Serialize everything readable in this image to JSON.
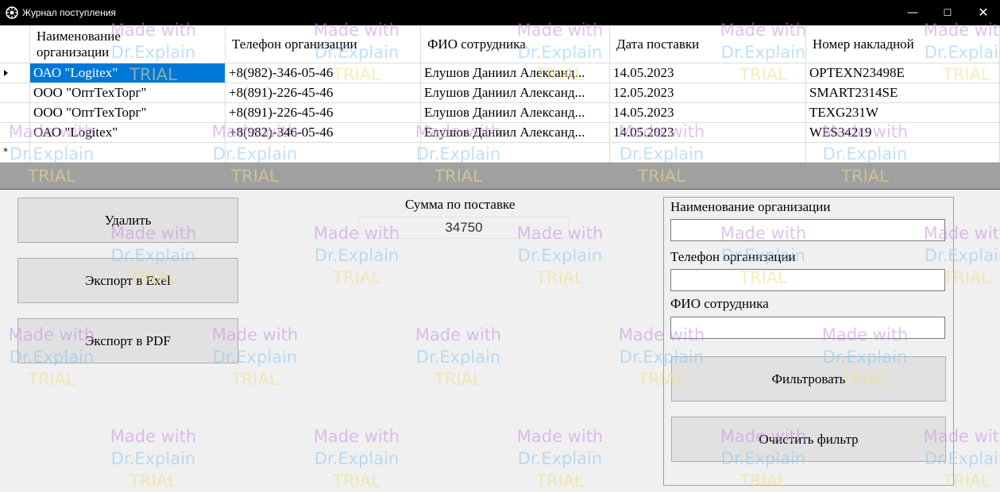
{
  "window": {
    "title": "Журнал поступления",
    "minimize": "—",
    "maximize": "☐",
    "close": "✕"
  },
  "grid": {
    "columns": [
      "Наименование организации",
      "Телефон организации",
      "ФИО сотрудника",
      "Дата поставки",
      "Номер накладной"
    ],
    "rows": [
      [
        "ОАО \"Logitex\"",
        "+8(982)-346-05-46",
        "Елушов Даниил Александ...",
        "14.05.2023",
        "OPTEXN23498E"
      ],
      [
        "ООО \"ОптТехТорг\"",
        "+8(891)-226-45-46",
        "Елушов Даниил Александ...",
        "12.05.2023",
        "SMART2314SE"
      ],
      [
        "ООО \"ОптТехТорг\"",
        "+8(891)-226-45-46",
        "Елушов Даниил Александ...",
        "14.05.2023",
        "TEXG231W"
      ],
      [
        "ОАО \"Logitex\"",
        "+8(982)-346-05-46",
        "Елушов Даниил Александ...",
        "14.05.2023",
        "WES34219"
      ]
    ]
  },
  "actions": {
    "delete": "Удалить",
    "export_excel": "Экспорт в Exel",
    "export_pdf": "Экспорт в PDF"
  },
  "sum": {
    "label": "Сумма по поставке",
    "value": "34750"
  },
  "filter": {
    "org_label": "Наименование организации",
    "org_value": "",
    "phone_label": "Телефон организации",
    "phone_value": "",
    "employee_label": "ФИО сотрудника",
    "employee_value": "",
    "apply": "Фильтровать",
    "clear": "Очистить фильтр"
  },
  "watermark": {
    "line1": "Made with",
    "line2": "Dr.Explain",
    "line3": "TRIAL"
  }
}
